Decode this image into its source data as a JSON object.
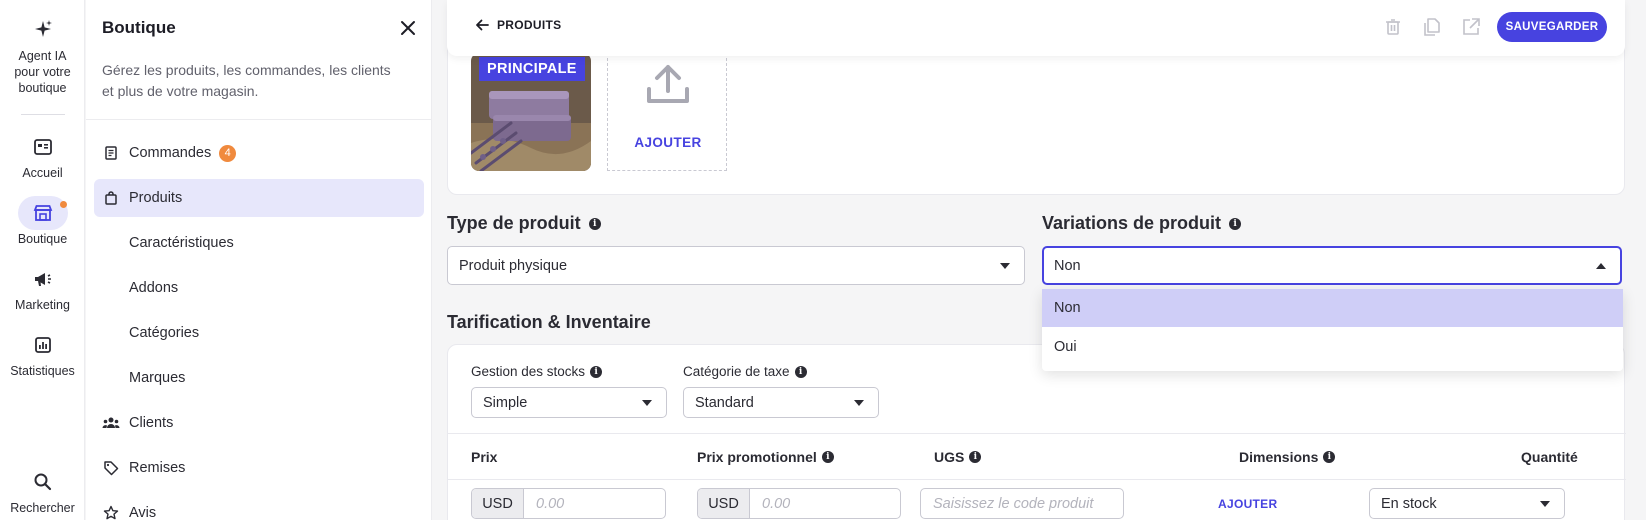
{
  "rail": {
    "ai_agent": "Agent IA pour votre boutique",
    "home": "Accueil",
    "shop": "Boutique",
    "marketing": "Marketing",
    "stats": "Statistiques",
    "search": "Rechercher"
  },
  "panel": {
    "title": "Boutique",
    "description": "Gérez les produits, les commandes, les clients et plus de votre magasin.",
    "items": [
      {
        "label": "Commandes",
        "icon": "receipt-icon",
        "badge": "4"
      },
      {
        "label": "Produits",
        "icon": "shopping-bag-icon",
        "active": true
      },
      {
        "label": "Caractéristiques"
      },
      {
        "label": "Addons"
      },
      {
        "label": "Catégories"
      },
      {
        "label": "Marques"
      },
      {
        "label": "Clients",
        "icon": "users-icon"
      },
      {
        "label": "Remises",
        "icon": "tag-icon"
      },
      {
        "label": "Avis",
        "icon": "star-icon"
      }
    ]
  },
  "topbar": {
    "back_label": "PRODUITS",
    "save_label": "SAUVEGARDER"
  },
  "media": {
    "main_tag": "PRINCIPALE",
    "add_label": "AJOUTER"
  },
  "product_type": {
    "heading": "Type de produit",
    "value": "Produit physique"
  },
  "variations": {
    "heading": "Variations de produit",
    "value": "Non",
    "options": [
      "Non",
      "Oui"
    ]
  },
  "pricing": {
    "heading": "Tarification & Inventaire",
    "stock_label": "Gestion des stocks",
    "stock_value": "Simple",
    "tax_label": "Catégorie de taxe",
    "tax_value": "Standard",
    "columns": {
      "price": "Prix",
      "promo": "Prix promotionnel",
      "sku": "UGS",
      "dimensions": "Dimensions",
      "quantity": "Quantité"
    },
    "currency": "USD",
    "price_placeholder": "0.00",
    "promo_placeholder": "0.00",
    "sku_placeholder": "Saisissez le code produit",
    "dimensions_add": "AJOUTER",
    "quantity_value": "En stock"
  },
  "colors": {
    "accent": "#4743e0",
    "badge": "#f08a3e",
    "active_bg": "#e7e7fb",
    "selected_option": "#cfcef7"
  }
}
